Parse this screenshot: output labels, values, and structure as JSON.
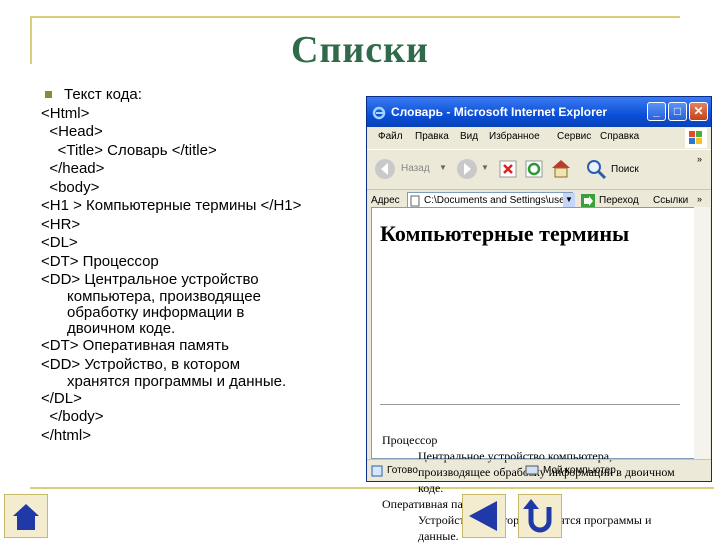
{
  "slide": {
    "title": "Списки",
    "code_lines": [
      "Текст кода:",
      "<Html>",
      "  <Head>",
      "    <Title> Словарь </title>",
      "  </head>",
      "  <body>",
      "<H1 > Компьютерные термины </H1>",
      "<HR>",
      "<DL>",
      "<DT> Процессор",
      "<DD> Центральное устройство",
      "компьютера, производящее",
      "обработку информации в",
      "двоичном коде.",
      "<DT> Оперативная память",
      "<DD> Устройство, в котором",
      "хранятся программы и данные.",
      "</DL>",
      "  </body>",
      "</html>"
    ]
  },
  "browser": {
    "title": "Словарь - Microsoft Internet Explorer",
    "menu": [
      "Файл",
      "Правка",
      "Вид",
      "Избранное",
      "Сервис",
      "Справка"
    ],
    "back_label": "Назад",
    "search_label": "Поиск",
    "address_label": "Адрес",
    "address_value": "C:\\Documents and Settings\\user\\Рабочий стол\\...",
    "go_label": "Переход",
    "links_label": "Ссылки",
    "page": {
      "h1": "Компьютерные термины",
      "terms": [
        {
          "dt": "Процессор",
          "dd": "Центральное устройство компьютера, производящее обработку информации в двоичном коде."
        },
        {
          "dt": "Оперативная память",
          "dd": "Устройство, в котором хранятся программы и данные."
        }
      ]
    },
    "status_left": "Готово",
    "status_right": "Мой компьютер"
  },
  "colors": {
    "title": "#2f6b4a",
    "frame": "#d8cf7a",
    "nav_fill": "#1f3aa8"
  }
}
